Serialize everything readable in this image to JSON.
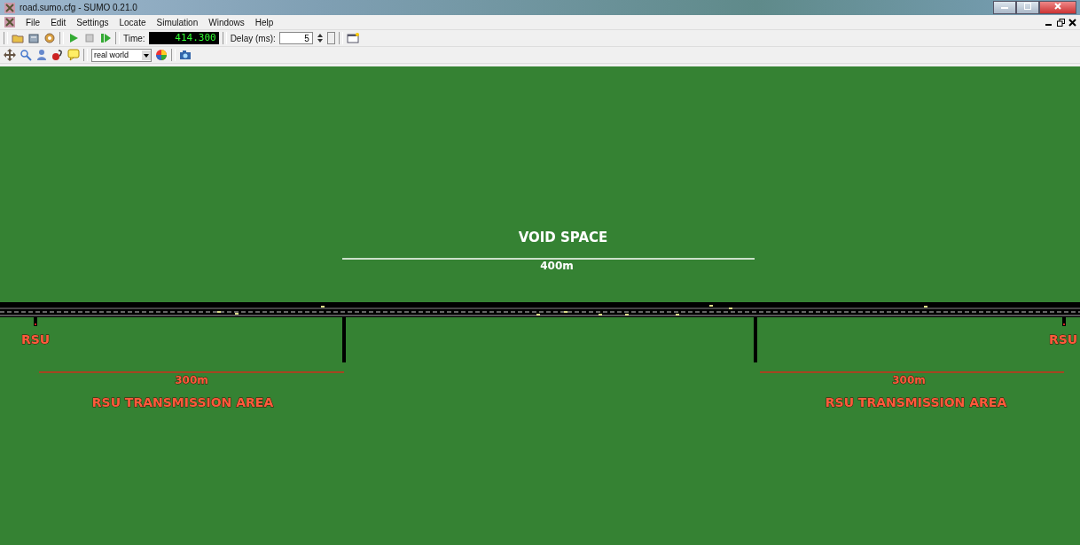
{
  "window": {
    "title": "road.sumo.cfg - SUMO 0.21.0"
  },
  "menu": [
    "File",
    "Edit",
    "Settings",
    "Locate",
    "Simulation",
    "Windows",
    "Help"
  ],
  "toolbar": {
    "time_label": "Time:",
    "time": "414.300",
    "delay_label": "Delay (ms):",
    "delay": "5"
  },
  "view_toolbar": {
    "scheme": "real world"
  },
  "canvas": {
    "labels": [
      {
        "kind": "title",
        "text": "VOID SPACE"
      },
      {
        "kind": "distance",
        "text": "400m"
      },
      {
        "kind": "rsu-left",
        "text": "RSU"
      },
      {
        "kind": "rsu-right",
        "text": "RSU"
      },
      {
        "kind": "range-left",
        "text": "300m"
      },
      {
        "kind": "area-left",
        "text": "RSU TRANSMISSION AREA"
      },
      {
        "kind": "range-right",
        "text": "300m"
      },
      {
        "kind": "area-right",
        "text": "RSU TRANSMISSION AREA"
      }
    ]
  }
}
